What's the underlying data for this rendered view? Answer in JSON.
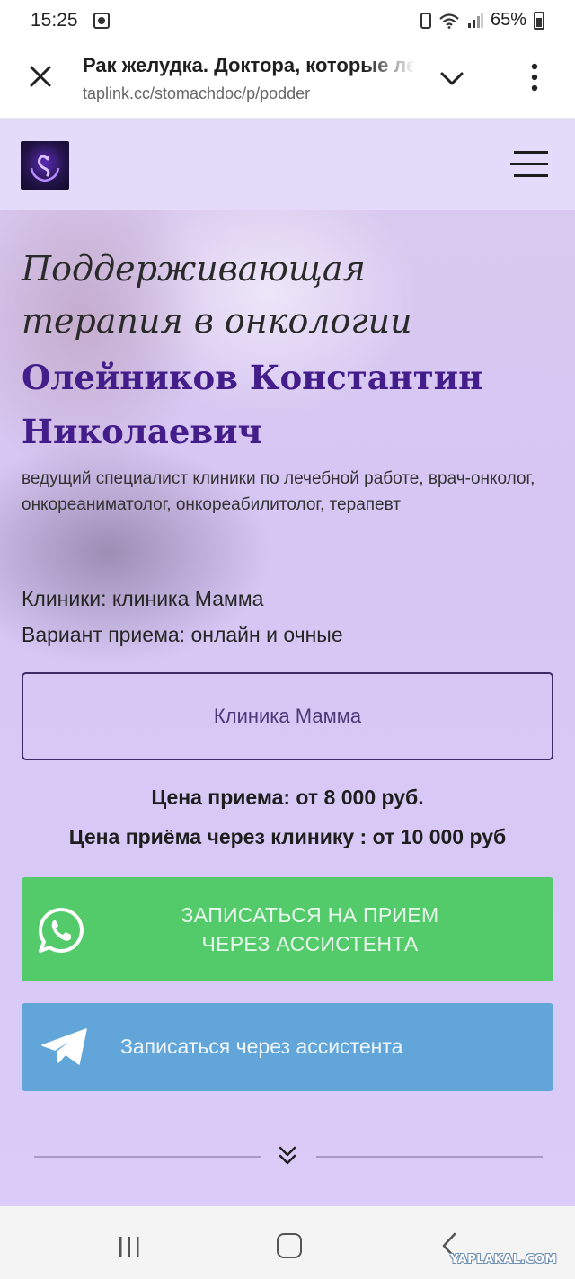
{
  "status_bar": {
    "time": "15:25",
    "battery": "65%"
  },
  "browser": {
    "title": "Рак желудка. Доктора, которые лечат рак",
    "url": "taplink.cc/stomachdoc/p/podder"
  },
  "hero": {
    "title_line1": "Поддерживающая",
    "title_line2": "терапия в онкологии",
    "doctor_name_line1": "Олейников Константин",
    "doctor_name_line2": "Николаевич",
    "description": "ведущий специалист клиники по лечебной работе, врач-онколог, онкореаниматолог, онкореабилитолог, терапевт",
    "clinics_line": "Клиники: клиника Мамма",
    "reception_line": "Вариант приема: онлайн и очные"
  },
  "buttons": {
    "clinic_label": "Клиника Мамма",
    "whatsapp_line1": "ЗАПИСАТЬСЯ НА ПРИЕМ",
    "whatsapp_line2": "ЧЕРЕЗ АССИСТЕНТА",
    "telegram_label": "Записаться через ассистента"
  },
  "prices": {
    "price_line": "Цена приема: от 8 000 руб.",
    "clinic_price_line": "Цена приёма через клинику : от 10 000 руб"
  },
  "watermark": "YAPLAKAL.COM",
  "colors": {
    "header_bg": "#e4dbfb",
    "doctor_name": "#431d8a",
    "whatsapp_green": "#54cb6b",
    "telegram_blue": "#62a5d9"
  }
}
